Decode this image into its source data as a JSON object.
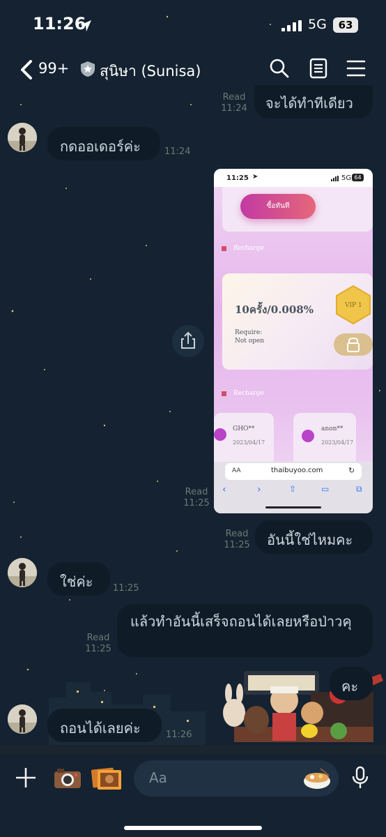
{
  "status_bar": {
    "time": "11:26",
    "network": "5G",
    "battery": "63"
  },
  "header": {
    "unread_count": "99+",
    "title": "สุนิษา (Sunisa)"
  },
  "messages": [
    {
      "side": "right",
      "text": "จะได้ทำทีเดียว",
      "status": "Read",
      "time": "11:24"
    },
    {
      "side": "left",
      "text": "กดออเดอร์ค่ะ",
      "time": "11:24"
    },
    {
      "side": "right",
      "type": "image",
      "status": "Read",
      "time": "11:25"
    },
    {
      "side": "right",
      "text": "อันนี้ใช่ไหมคะ",
      "status": "Read",
      "time": "11:25"
    },
    {
      "side": "left",
      "text": "ใช่ค่ะ",
      "time": "11:25"
    },
    {
      "side": "right",
      "text": "แล้วทำอันนี้เสร็จถอนได้เลยหรือป่าวคุ",
      "status": "Read",
      "time": "11:25"
    },
    {
      "side": "right",
      "text": "คะ"
    },
    {
      "side": "left",
      "text": "ถอนได้เลยค่ะ",
      "time": "11:26"
    }
  ],
  "screenshot": {
    "time": "11:25",
    "network": "5G",
    "battery": "64",
    "buy_button": "ซื้อทันที",
    "section_label": "Recharge",
    "card_title": "10ครั้ง/0.008%",
    "card_require": "Require:",
    "card_status": "Not open",
    "vip_label": "VIP 1",
    "users": [
      {
        "name": "GHO**",
        "date": "2023/04/17"
      },
      {
        "name": "anon**",
        "date": "2023/04/17"
      }
    ],
    "url_prefix": "AA",
    "url": "thaibuyoo.com"
  },
  "composer": {
    "placeholder": "Aa"
  },
  "colors": {
    "background": "#142231",
    "bubble": "#0f1c28",
    "accent": "#f2c94c"
  }
}
